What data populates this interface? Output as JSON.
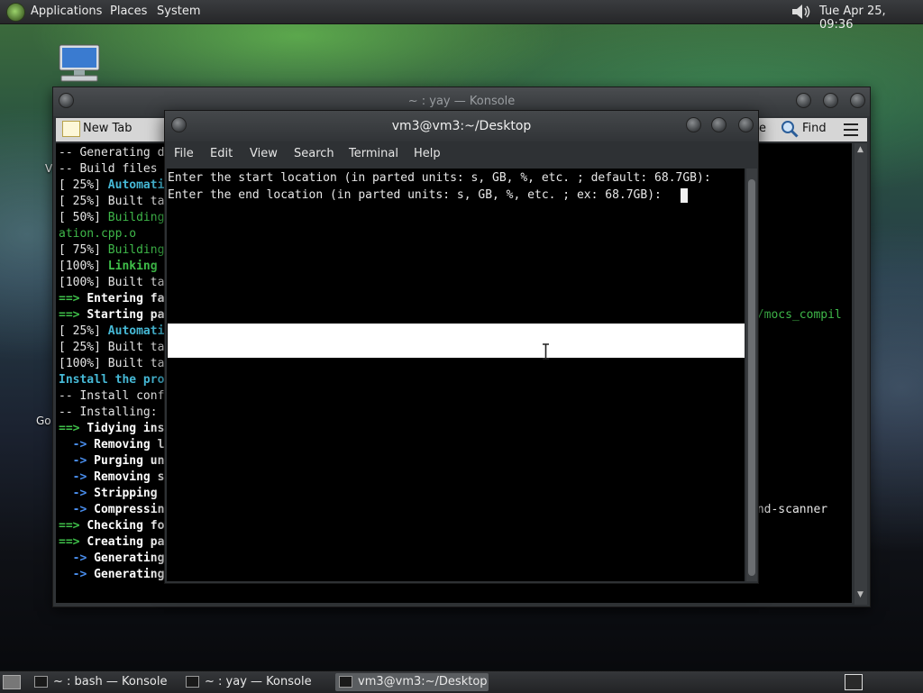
{
  "top_panel": {
    "menus": [
      "Applications",
      "Places",
      "System"
    ],
    "clock": "Tue Apr 25, 09:36",
    "volume_icon": "speaker-icon"
  },
  "desktop": {
    "labels": [
      "V",
      "Go"
    ]
  },
  "back_window": {
    "title": "~ : yay — Konsole",
    "toolbar": {
      "new_tab": "New Tab",
      "find": "Find",
      "partial_label": "e"
    },
    "lines": [
      [
        {
          "t": "-- Generating d",
          "c": "c-white"
        },
        {
          "t": "",
          "c": ""
        }
      ],
      [
        {
          "t": "-- Build files ",
          "c": "c-white"
        },
        {
          "t": "",
          "c": ""
        }
      ],
      [
        {
          "t": "[ 25%] ",
          "c": "c-white"
        },
        {
          "t": "Automati",
          "c": "c-cyan"
        }
      ],
      [
        {
          "t": "[ 25%] Built ta",
          "c": "c-white"
        },
        {
          "t": "",
          "c": ""
        }
      ],
      [
        {
          "t": "[ 50%] ",
          "c": "c-white"
        },
        {
          "t": "Building",
          "c": "c-green"
        }
      ],
      [
        {
          "t": "ation.cpp.o",
          "c": "c-green"
        },
        {
          "t": "",
          "c": ""
        }
      ],
      [
        {
          "t": "[ 75%] ",
          "c": "c-white"
        },
        {
          "t": "Building",
          "c": "c-green"
        }
      ],
      [
        {
          "t": "[100%] ",
          "c": "c-white"
        },
        {
          "t": "Linking ",
          "c": "c-greenb"
        }
      ],
      [
        {
          "t": "[100%] Built ta",
          "c": "c-white"
        },
        {
          "t": "",
          "c": ""
        }
      ],
      [
        {
          "t": "==> ",
          "c": "c-greenb"
        },
        {
          "t": "Entering fa",
          "c": "c-bold"
        }
      ],
      [
        {
          "t": "==> ",
          "c": "c-greenb"
        },
        {
          "t": "Starting pa",
          "c": "c-bold"
        }
      ],
      [
        {
          "t": "[ 25%] ",
          "c": "c-white"
        },
        {
          "t": "Automati",
          "c": "c-cyan"
        }
      ],
      [
        {
          "t": "[ 25%] Built ta",
          "c": "c-white"
        },
        {
          "t": "",
          "c": ""
        }
      ],
      [
        {
          "t": "[100%] Built ta",
          "c": "c-white"
        },
        {
          "t": "",
          "c": ""
        }
      ],
      [
        {
          "t": "Install the pro",
          "c": "c-cyan"
        },
        {
          "t": "",
          "c": ""
        }
      ],
      [
        {
          "t": "-- Install conf",
          "c": "c-white"
        },
        {
          "t": "",
          "c": ""
        }
      ],
      [
        {
          "t": "-- Installing: ",
          "c": "c-white"
        },
        {
          "t": "",
          "c": ""
        }
      ],
      [
        {
          "t": "==> ",
          "c": "c-greenb"
        },
        {
          "t": "Tidying ins",
          "c": "c-bold"
        }
      ],
      [
        {
          "t": "  -> ",
          "c": "c-arrow"
        },
        {
          "t": "Removing l",
          "c": "c-bold"
        }
      ],
      [
        {
          "t": "  -> ",
          "c": "c-arrow"
        },
        {
          "t": "Purging un",
          "c": "c-bold"
        }
      ],
      [
        {
          "t": "  -> ",
          "c": "c-arrow"
        },
        {
          "t": "Removing s",
          "c": "c-bold"
        }
      ],
      [
        {
          "t": "  -> ",
          "c": "c-arrow"
        },
        {
          "t": "Stripping ",
          "c": "c-bold"
        }
      ],
      [
        {
          "t": "  -> ",
          "c": "c-arrow"
        },
        {
          "t": "Compressin",
          "c": "c-bold"
        }
      ],
      [
        {
          "t": "==> ",
          "c": "c-greenb"
        },
        {
          "t": "Checking fo",
          "c": "c-bold"
        }
      ],
      [
        {
          "t": "==> ",
          "c": "c-greenb"
        },
        {
          "t": "Creating pa",
          "c": "c-bold"
        }
      ],
      [
        {
          "t": "  -> ",
          "c": "c-arrow"
        },
        {
          "t": "Generating",
          "c": "c-bold"
        }
      ],
      [
        {
          "t": "  -> ",
          "c": "c-arrow"
        },
        {
          "t": "Generating ",
          "c": "c-bold"
        }
      ]
    ],
    "right_fragments": {
      "mocs": "n/mocs_compil",
      "scanner": "and-scanner"
    }
  },
  "front_window": {
    "title": "vm3@vm3:~/Desktop",
    "menus": [
      "File",
      "Edit",
      "View",
      "Search",
      "Terminal",
      "Help"
    ],
    "lines": [
      "Enter the start location (in parted units: s, GB, %, etc. ; default: 68.7GB):",
      "Enter the end location (in parted units: s, GB, %, etc. ; ex: 68.7GB): "
    ]
  },
  "taskbar": {
    "tasks": [
      "~ : bash — Konsole",
      "~ : yay — Konsole",
      "vm3@vm3:~/Desktop"
    ],
    "active_index": 2
  }
}
